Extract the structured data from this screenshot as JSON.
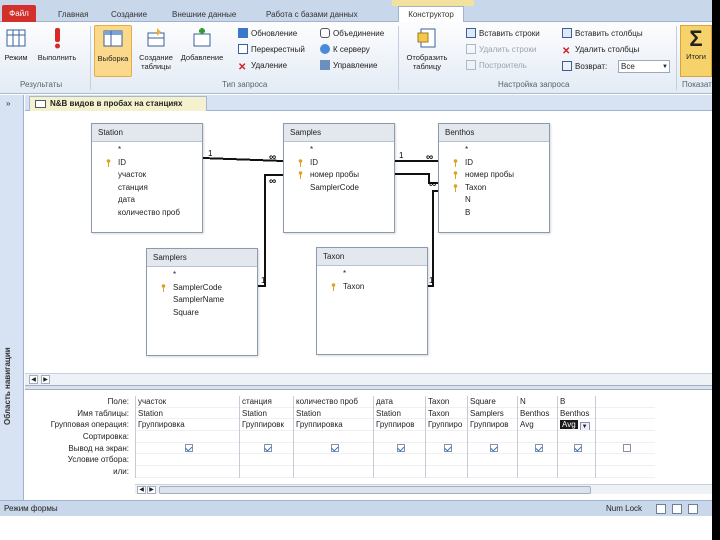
{
  "tabs": {
    "file": "Файл",
    "home": "Главная",
    "create": "Создание",
    "external": "Внешние данные",
    "dbtools": "Работа с базами данных",
    "constructor": "Конструктор"
  },
  "ribbon": {
    "groups": {
      "results": "Результаты",
      "query_type": "Тип запроса",
      "query_setup": "Настройка запроса",
      "show_hide": "Показать"
    },
    "results": {
      "mode": "Режим",
      "run": "Выполнить"
    },
    "query_type": {
      "select": "Выборка",
      "make_table_1": "Создание",
      "make_table_2": "таблицы",
      "append": "Добавление",
      "update": "Обновление",
      "crosstab": "Перекрестный",
      "delete": "Удаление",
      "union": "Объединение",
      "to_server": "К серверу",
      "manage": "Управление"
    },
    "query_setup": {
      "show_table_1": "Отобразить",
      "show_table_2": "таблицу",
      "insert_rows": "Вставить строки",
      "delete_rows": "Удалить строки",
      "builder": "Построитель",
      "insert_cols": "Вставить столбцы",
      "delete_cols": "Удалить столбцы",
      "return": "Возврат:",
      "return_value": "Все"
    },
    "totals": "Итоги",
    "totals_icon": "Σ"
  },
  "nav": {
    "label": "Область навигации",
    "toggle": "»"
  },
  "document": {
    "title": "N&B видов в пробах на станциях"
  },
  "tables": {
    "station": {
      "name": "Station",
      "fields": [
        "*",
        "ID",
        "участок",
        "станция",
        "дата",
        "количество проб"
      ]
    },
    "samples": {
      "name": "Samples",
      "fields": [
        "*",
        "ID",
        "номер пробы",
        "SamplerCode"
      ]
    },
    "benthos": {
      "name": "Benthos",
      "fields": [
        "*",
        "ID",
        "номер пробы",
        "Taxon",
        "N",
        "B"
      ]
    },
    "samplers": {
      "name": "Samplers",
      "fields": [
        "*",
        "SamplerCode",
        "SamplerName",
        "Square"
      ]
    },
    "taxon": {
      "name": "Taxon",
      "fields": [
        "*",
        "Taxon"
      ]
    }
  },
  "relations": {
    "one": "1",
    "many": "∞"
  },
  "grid": {
    "row_labels": [
      "Поле:",
      "Имя таблицы:",
      "Групповая операция:",
      "Сортировка:",
      "Вывод на экран:",
      "Условие отбора:",
      "или:"
    ],
    "columns": [
      {
        "field": "участок",
        "table": "Station",
        "group": "Группировка",
        "show": true
      },
      {
        "field": "станция",
        "table": "Station",
        "group": "Группировк",
        "show": true
      },
      {
        "field": "количество проб",
        "table": "Station",
        "group": "Группировка",
        "show": true
      },
      {
        "field": "дата",
        "table": "Station",
        "group": "Группиров",
        "show": true
      },
      {
        "field": "Taxon",
        "table": "Taxon",
        "group": "Группиро",
        "show": true
      },
      {
        "field": "Square",
        "table": "Samplers",
        "group": "Группиров",
        "show": true
      },
      {
        "field": "N",
        "table": "Benthos",
        "group": "Avg",
        "show": true
      },
      {
        "field": "B",
        "table": "Benthos",
        "group": "Avg",
        "show": true
      },
      {
        "field": "",
        "table": "",
        "group": "",
        "show": false
      }
    ]
  },
  "status": {
    "left": "Режим формы",
    "right": "Num Lock"
  },
  "colors": {
    "file_tab": "#d2302c",
    "ribbon_bg": "#e3ebf5",
    "accent": "#f6d26b"
  }
}
